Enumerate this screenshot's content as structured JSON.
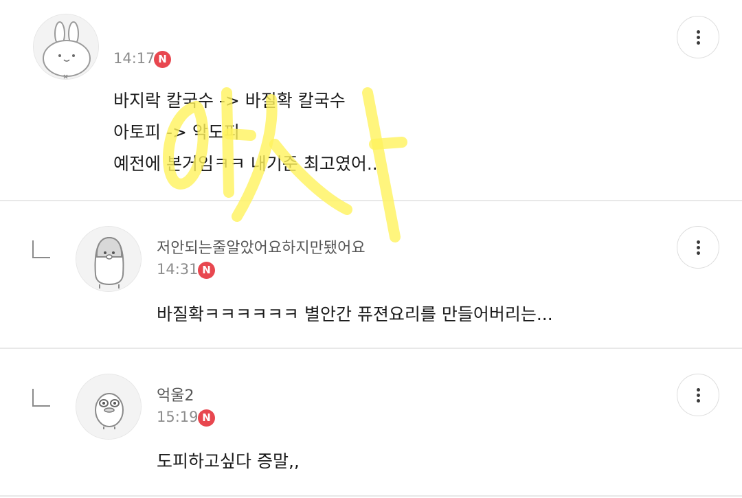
{
  "comments": [
    {
      "nickname": "",
      "time": "14:17",
      "badge": "N",
      "avatar_icon": "rabbit-avatar-icon",
      "lines": [
        "바지락 칼국수 -> 바질확 칼국수",
        "아토피 -> 악도피",
        "예전에 본거임ㅋㅋ 내기준 최고였어.."
      ]
    },
    {
      "nickname": "저안되는줄알았어요하지만됐어요",
      "time": "14:31",
      "badge": "N",
      "avatar_icon": "penguin-avatar-icon",
      "lines": [
        "바질확ㅋㅋㅋㅋㅋㅋ 별안간 퓨젼요리를 만들어버리는..."
      ]
    },
    {
      "nickname": "억울2",
      "time": "15:19",
      "badge": "N",
      "avatar_icon": "duck-avatar-icon",
      "lines": [
        "도피하고싶다 증말,,"
      ]
    }
  ],
  "colors": {
    "badge": "#e8474f",
    "highlighter": "#fff35c",
    "divider": "#e8e8e8"
  },
  "icons": {
    "more": "more-vertical-icon",
    "reply": "reply-arrow-icon"
  }
}
